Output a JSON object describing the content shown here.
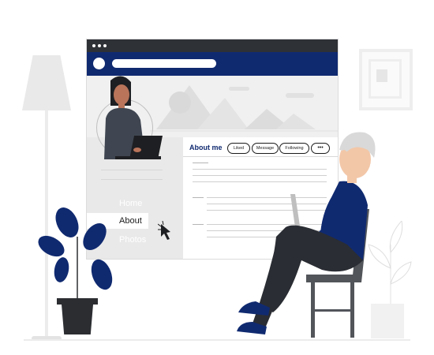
{
  "browser": {
    "profile": {
      "nav_items": [
        "Home",
        "About",
        "Photos"
      ],
      "active_item": "About",
      "section_title": "About me",
      "actions": [
        "Liked",
        "Message",
        "Following",
        "•••"
      ]
    }
  },
  "colors": {
    "navy": "#102a70",
    "titlebar": "#2e3136",
    "sidebar": "#e9e9e9",
    "cover": "#f0f0f0",
    "chair": "#52555a",
    "pants": "#2a2d33"
  },
  "icons": [
    "window-dots",
    "profile-circle-icon",
    "search-bar",
    "mountain-cover-image",
    "cursor-icon",
    "dots-icon"
  ]
}
